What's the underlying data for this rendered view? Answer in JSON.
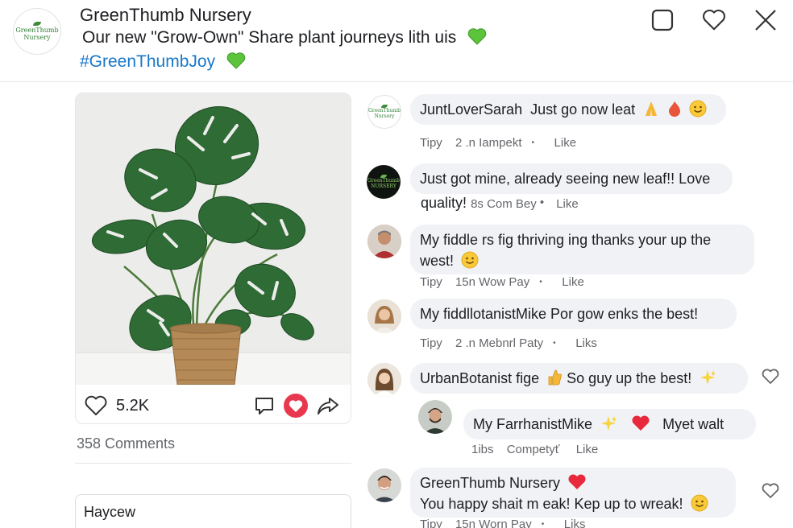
{
  "post": {
    "page_name": "GreenThumb Nursery",
    "logo_text_1": "GreenThumb",
    "logo_text_2": "Nursery",
    "text": "Our new \"Grow-Own\" Share plant journeys lith uis",
    "hashtag": "#GreenThumbJoy",
    "likes": "5.2K",
    "comments_count": "358 Comments",
    "input_label": "Haycew"
  },
  "colors": {
    "link_blue": "#1877c9",
    "heart_red": "#e8384f",
    "emoji_green": "#4caf50",
    "bubble_gray": "#f0f2f5"
  },
  "comments": [
    {
      "author": "JuntLoverSarah",
      "text": "Just go now leat",
      "emojis": [
        "folded-hands",
        "fire",
        "smile"
      ],
      "meta": [
        "Tipy",
        "2 .n Iampekt",
        "Like"
      ],
      "avatar_text_1": "GreenThumb",
      "avatar_text_2": "Nursery"
    },
    {
      "author": "",
      "text_line1": "Just got mine, already seeing new leaf!! Love",
      "text_line2": "quality!",
      "inline_meta": "8s Com Bey",
      "inline_like": "Like",
      "avatar_text_1": "GreenThumb",
      "avatar_text_2": "NURSERY"
    },
    {
      "text_line1": "My fiddle rs fig thriving ing thanks your  up the",
      "text_line2": "west!",
      "meta": [
        "Tipy",
        "15n Wow Pay",
        "Like"
      ]
    },
    {
      "text": "My fiddllotanistMike Por gow enks the best!",
      "meta": [
        "Tipy",
        "2 .n Mebnrl Paty",
        "Liks"
      ]
    },
    {
      "text": "UrbanBotanist fige",
      "text_after": "So guy up the best!"
    },
    {
      "text": "My FarrhanistMike",
      "text_after": "Myet walt",
      "meta": [
        "1ibs",
        "Competyť",
        "Like"
      ]
    },
    {
      "author": "GreenThumb Nursery",
      "text": "You happy shait m eak! Kep up to wreak!",
      "meta": [
        "Tipy",
        "15n Worn Pay",
        "Liks"
      ]
    }
  ]
}
